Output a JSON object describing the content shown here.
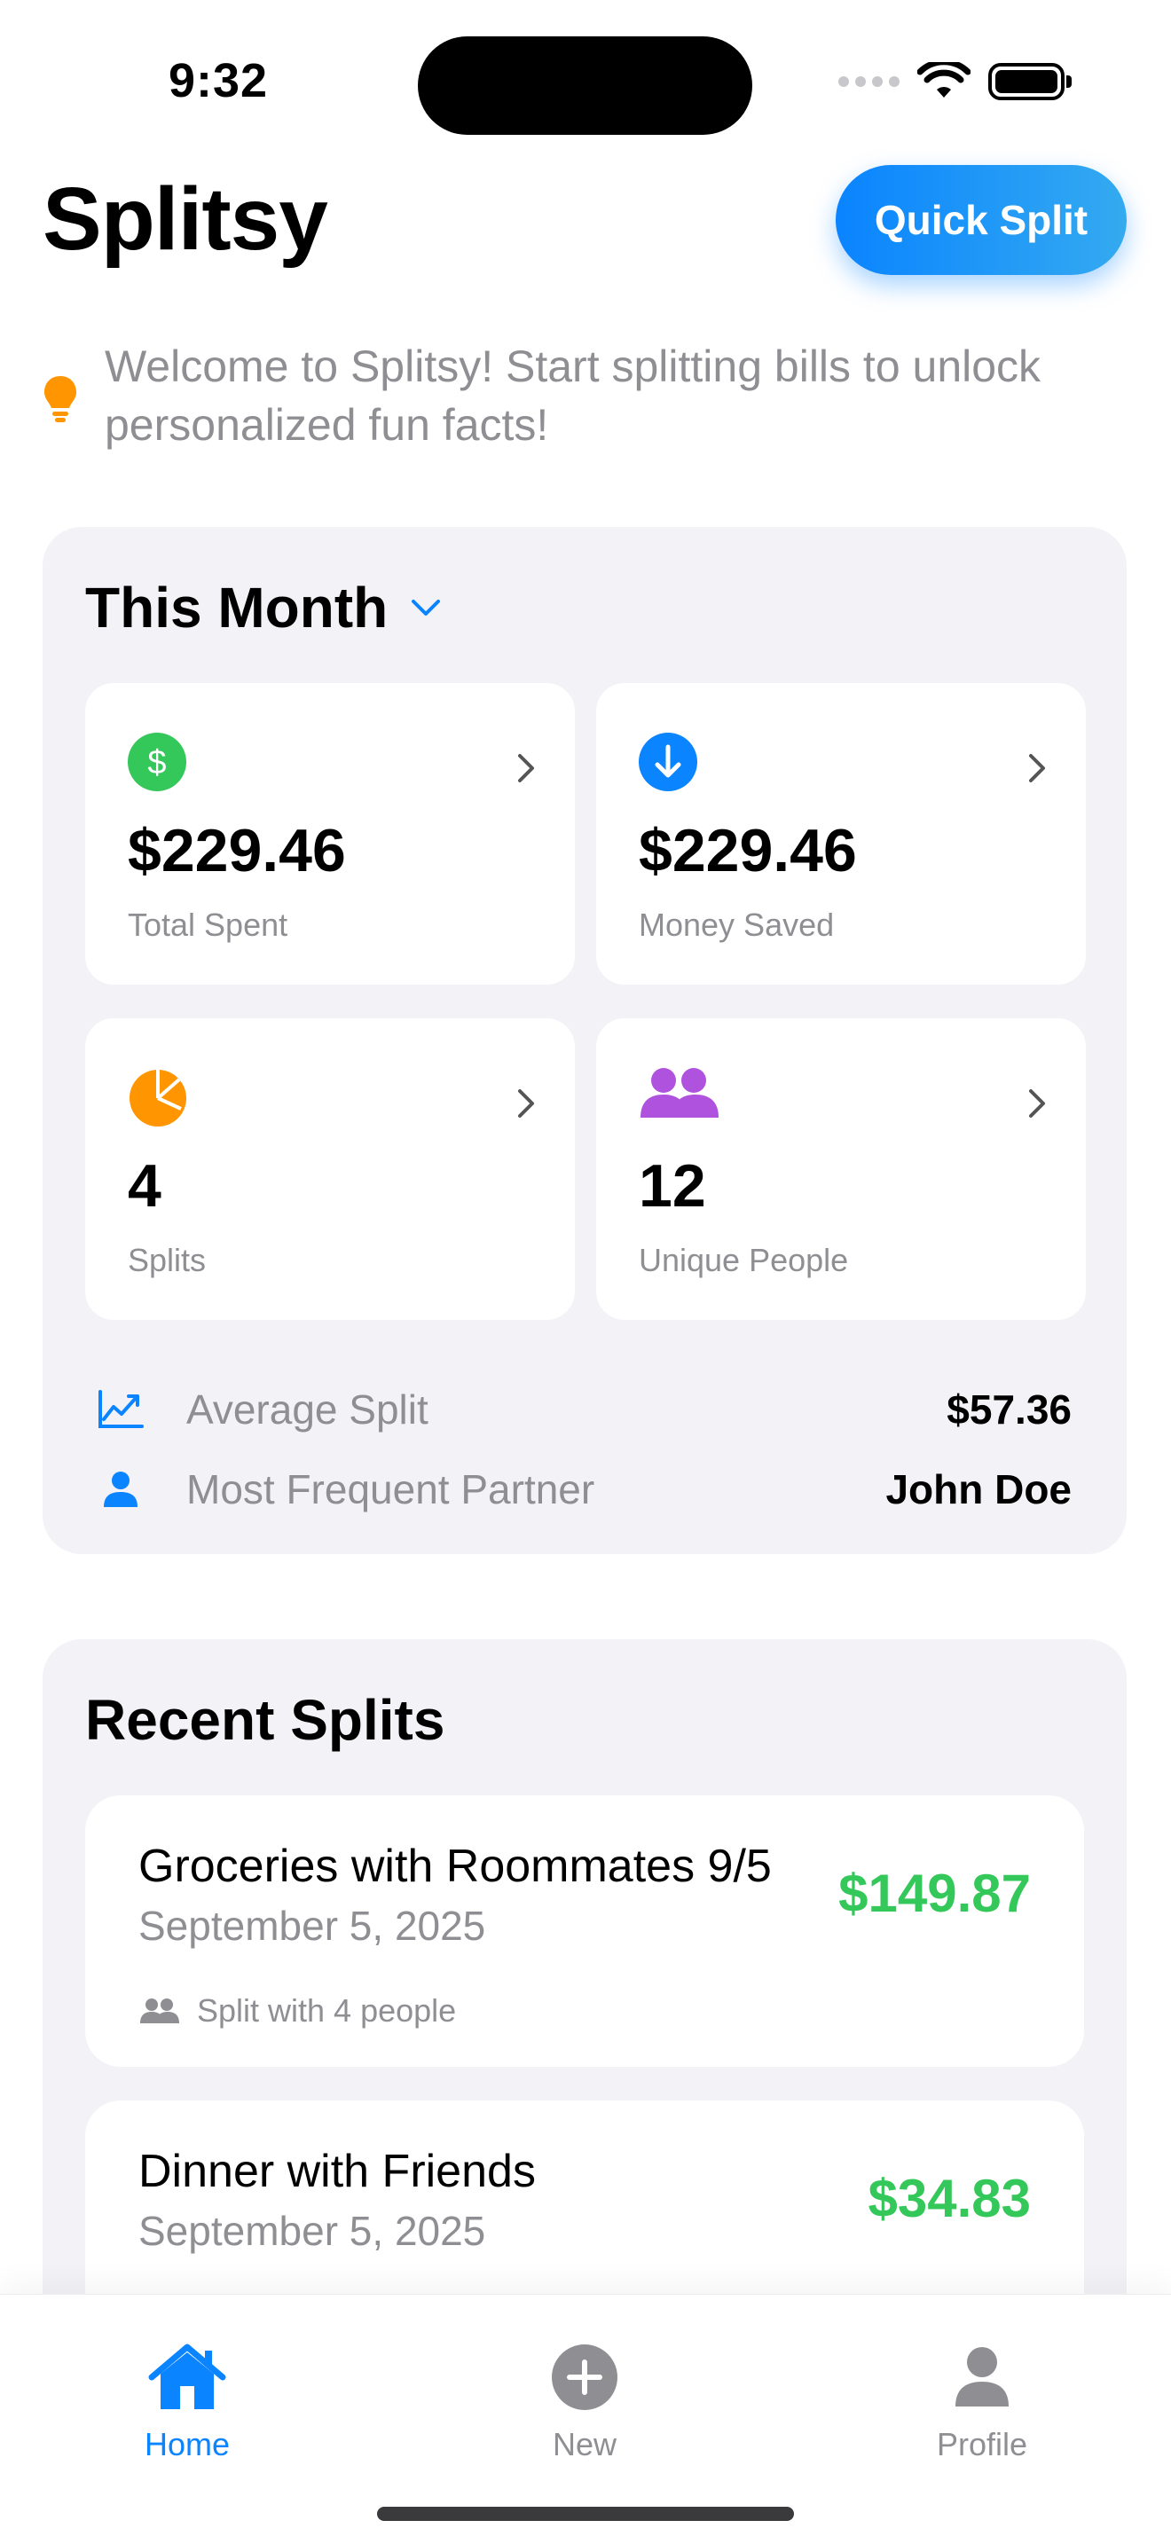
{
  "status_bar": {
    "time": "9:32"
  },
  "header": {
    "title": "Splitsy",
    "quick_split_label": "Quick Split"
  },
  "fun_fact": {
    "text": "Welcome to Splitsy! Start splitting bills to unlock personalized fun facts!",
    "icon": "lightbulb-icon"
  },
  "this_month": {
    "title": "This Month",
    "tiles": [
      {
        "value": "$229.46",
        "label": "Total Spent",
        "icon": "dollar-circle-icon",
        "color": "#34c759"
      },
      {
        "value": "$229.46",
        "label": "Money Saved",
        "icon": "arrow-down-circle-icon",
        "color": "#0a84ff"
      },
      {
        "value": "4",
        "label": "Splits",
        "icon": "pie-chart-icon",
        "color": "#ff9500"
      },
      {
        "value": "12",
        "label": "Unique People",
        "icon": "people-icon",
        "color": "#af52de"
      }
    ],
    "metrics": [
      {
        "label": "Average Split",
        "value": "$57.36",
        "icon": "trend-chart-icon"
      },
      {
        "label": "Most Frequent Partner",
        "value": "John Doe",
        "icon": "person-icon"
      }
    ]
  },
  "recent_splits": {
    "title": "Recent Splits",
    "items": [
      {
        "name": "Groceries with Roommates 9/5",
        "date": "September 5, 2025",
        "amount": "$149.87",
        "people": "Split with 4 people"
      },
      {
        "name": "Dinner with Friends",
        "date": "September 5, 2025",
        "amount": "$34.83"
      }
    ]
  },
  "tab_bar": {
    "active_color": "#0a84ff",
    "inactive_color": "#8e8e93",
    "tabs": [
      {
        "label": "Home",
        "icon": "house-icon",
        "active": true
      },
      {
        "label": "New",
        "icon": "plus-circle-icon",
        "active": false
      },
      {
        "label": "Profile",
        "icon": "person-icon",
        "active": false
      }
    ]
  }
}
